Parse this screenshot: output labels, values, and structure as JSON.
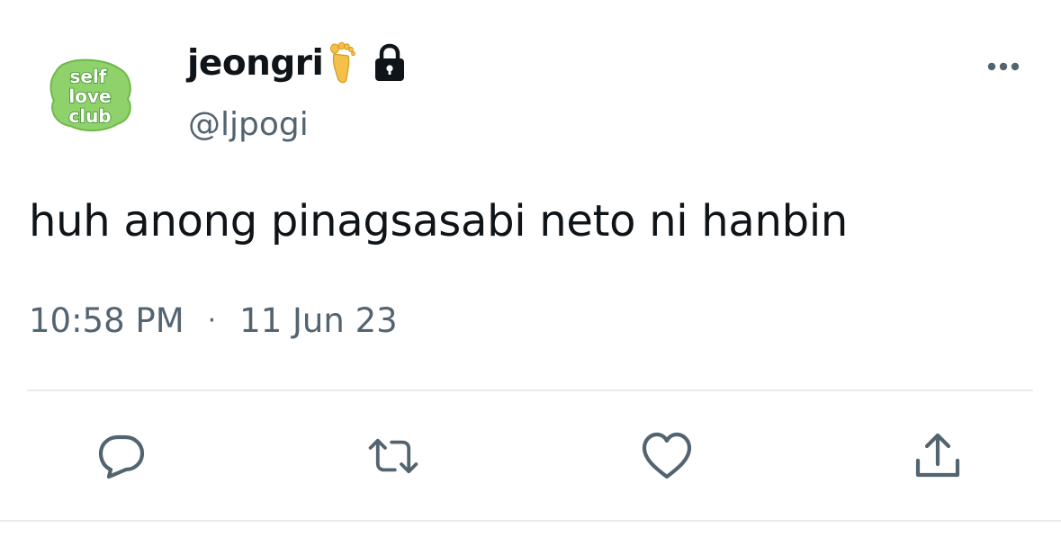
{
  "author": {
    "display_name": "jeongri",
    "handle": "@ljpogi",
    "avatar_text": [
      "self",
      "love",
      "club"
    ],
    "badges": [
      "foot-emoji-icon",
      "lock-icon"
    ]
  },
  "tweet": {
    "text": "huh anong pinagsasabi neto ni hanbin",
    "time": "10:58 PM",
    "separator": "·",
    "date": "11 Jun 23"
  },
  "actions": [
    "reply-icon",
    "retweet-icon",
    "like-icon",
    "share-icon"
  ],
  "colors": {
    "text_primary": "#0f1419",
    "text_secondary": "#536471",
    "icon": "#536471",
    "divider": "#e6ecf0",
    "avatar_green": "#8fd16a",
    "avatar_dark_green": "#3f8f2a"
  }
}
